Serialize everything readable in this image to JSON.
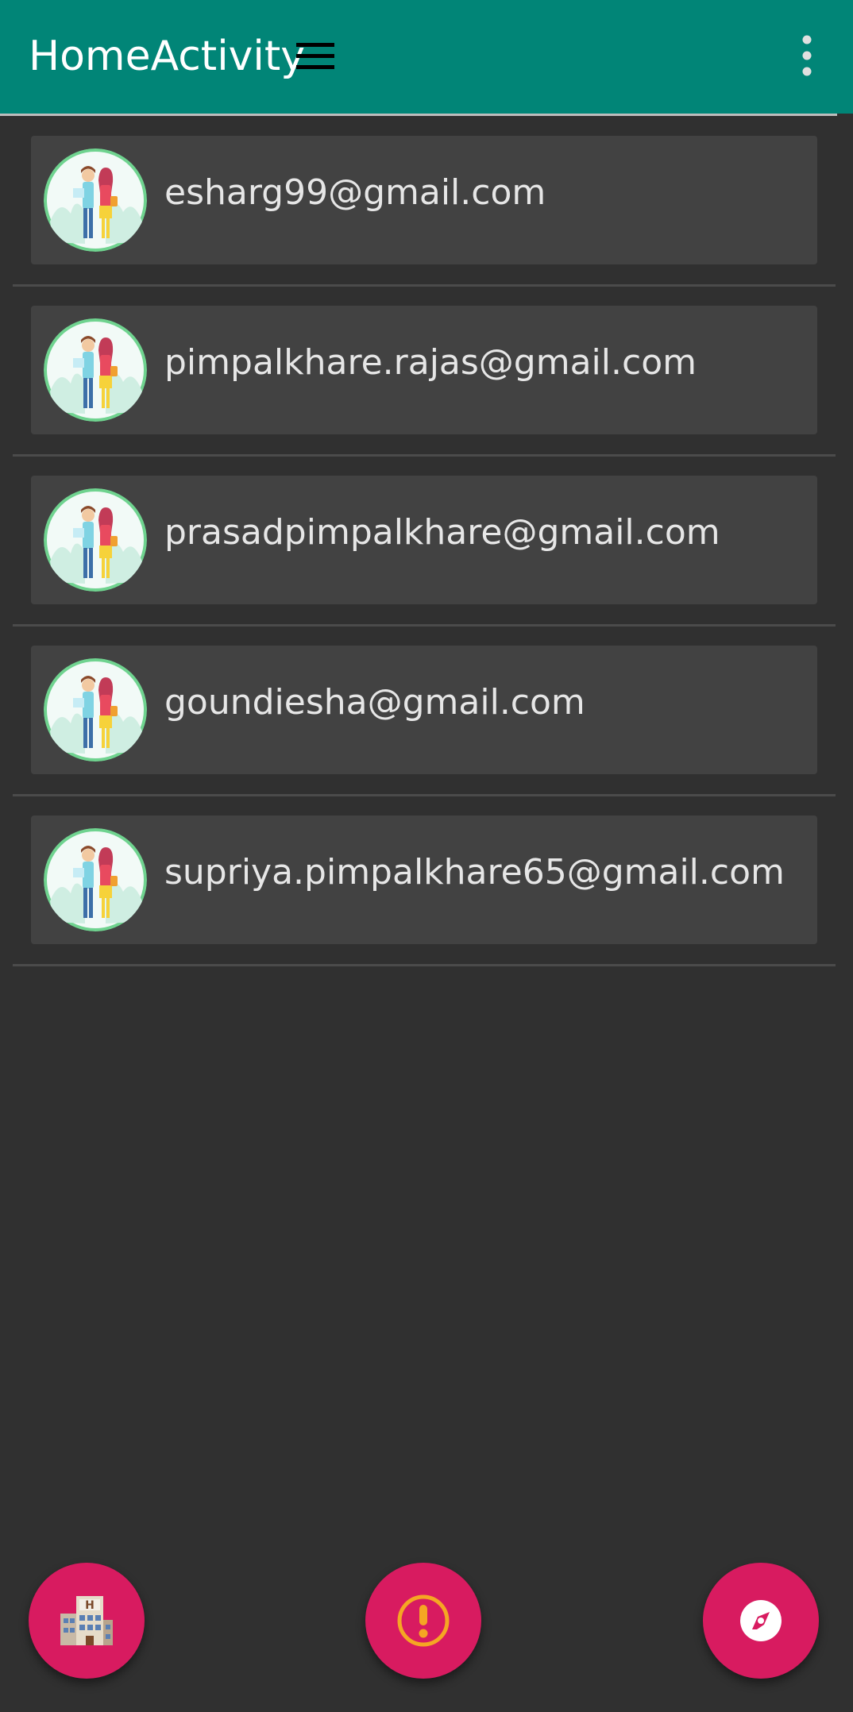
{
  "appbar": {
    "title": "HomeActivity",
    "menu_icon": "hamburger-menu-icon",
    "overflow_icon": "more-vert-icon",
    "color": "#018577"
  },
  "contacts": [
    {
      "email": "esharg99@gmail.com",
      "avatar": "couple-avatar"
    },
    {
      "email": "pimpalkhare.rajas@gmail.com",
      "avatar": "couple-avatar"
    },
    {
      "email": "prasadpimpalkhare@gmail.com",
      "avatar": "couple-avatar"
    },
    {
      "email": "goundiesha@gmail.com",
      "avatar": "couple-avatar"
    },
    {
      "email": "supriya.pimpalkhare65@gmail.com",
      "avatar": "couple-avatar"
    }
  ],
  "fabs": [
    {
      "icon": "hotel-building-icon"
    },
    {
      "icon": "alert-exclamation-icon"
    },
    {
      "icon": "compass-icon"
    }
  ],
  "colors": {
    "background": "#303030",
    "card": "#424242",
    "fab": "#d81b60",
    "alert": "#f5a623"
  }
}
